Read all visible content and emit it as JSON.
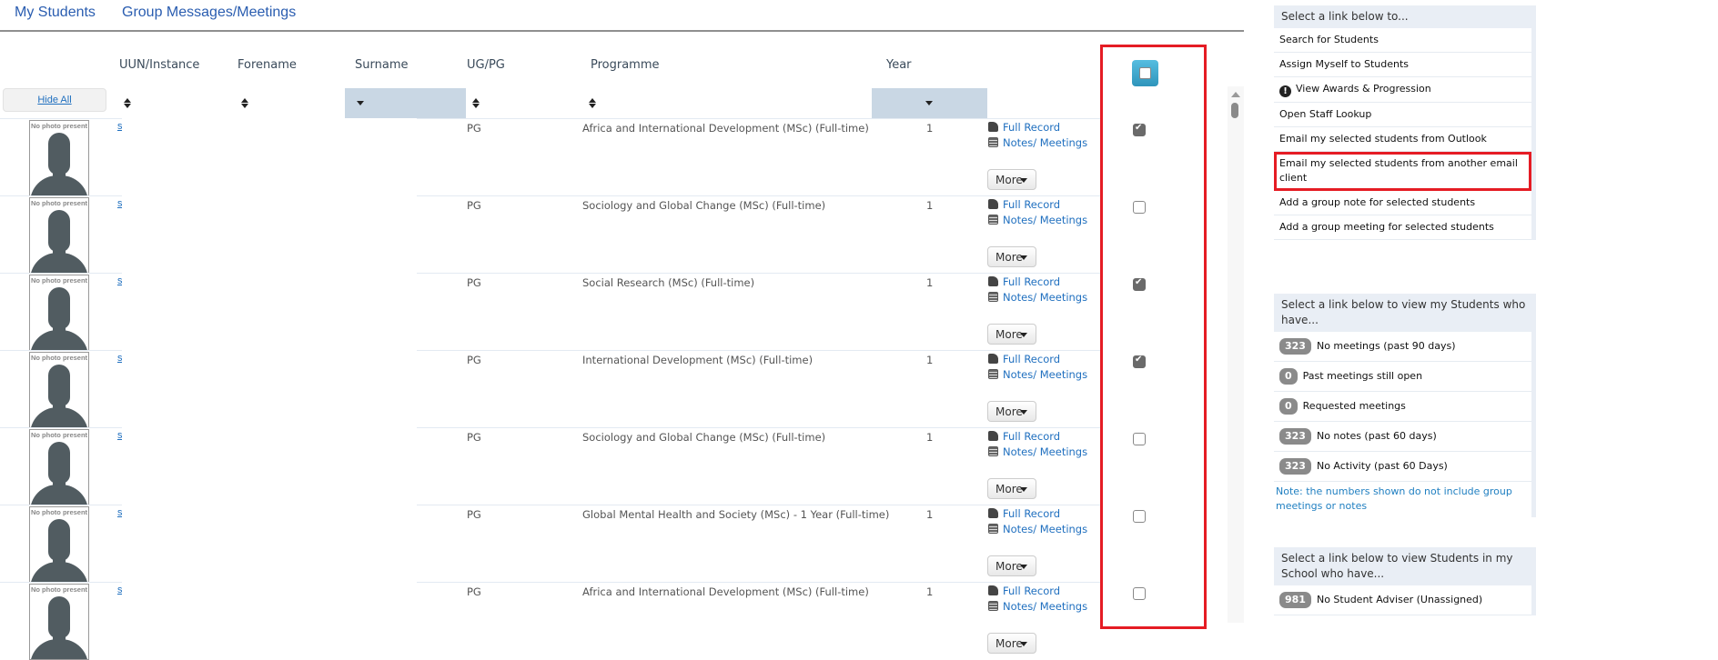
{
  "tabs": [
    {
      "label": "My Students"
    },
    {
      "label": "Group Messages/Meetings"
    }
  ],
  "table": {
    "columns": {
      "uun": "UUN/Instance",
      "forename": "Forename",
      "surname": "Surname",
      "ugpg": "UG/PG",
      "programme": "Programme",
      "year": "Year"
    },
    "hide_all_label": "Hide All",
    "photo_placeholder": "No photo present",
    "full_record_label": "Full Record",
    "notes_label": "Notes/ Meetings",
    "more_label": "More",
    "rows": [
      {
        "uun": "s",
        "ugpg": "PG",
        "programme": "Africa and International Development (MSc) (Full-time)",
        "year": "1",
        "selected": true
      },
      {
        "uun": "s",
        "ugpg": "PG",
        "programme": "Sociology and Global Change (MSc) (Full-time)",
        "year": "1",
        "selected": false
      },
      {
        "uun": "s",
        "ugpg": "PG",
        "programme": "Social Research (MSc) (Full-time)",
        "year": "1",
        "selected": true
      },
      {
        "uun": "s",
        "ugpg": "PG",
        "programme": "International Development (MSc) (Full-time)",
        "year": "1",
        "selected": true
      },
      {
        "uun": "s",
        "ugpg": "PG",
        "programme": "Sociology and Global Change (MSc) (Full-time)",
        "year": "1",
        "selected": false
      },
      {
        "uun": "s",
        "ugpg": "PG",
        "programme": "Global Mental Health and Society (MSc) - 1 Year (Full-time)",
        "year": "1",
        "selected": false
      },
      {
        "uun": "s",
        "ugpg": "PG",
        "programme": "Africa and International Development (MSc) (Full-time)",
        "year": "1",
        "selected": false
      }
    ]
  },
  "sidebar": {
    "actions_panel": {
      "title": "Select a link below to...",
      "items": [
        {
          "label": "Search for Students"
        },
        {
          "label": "Assign Myself to Students"
        },
        {
          "label": "View Awards & Progression",
          "icon": "exclamation-circle-icon"
        },
        {
          "label": "Open Staff Lookup"
        },
        {
          "label": "Email my selected students from Outlook"
        },
        {
          "label": "Email my selected students from another email client",
          "highlighted": true
        },
        {
          "label": "Add a group note for selected students"
        },
        {
          "label": "Add a group meeting for selected students"
        }
      ]
    },
    "my_students_panel": {
      "title": "Select a link below to view my Students who have...",
      "items": [
        {
          "count": "323",
          "label": "No meetings (past 90 days)"
        },
        {
          "count": "0",
          "label": "Past meetings still open"
        },
        {
          "count": "0",
          "label": "Requested meetings"
        },
        {
          "count": "323",
          "label": "No notes (past 60 days)"
        },
        {
          "count": "323",
          "label": "No Activity (past 60 Days)"
        }
      ],
      "note": "Note: the numbers shown do not include group meetings or notes"
    },
    "school_panel": {
      "title": "Select a link below to view Students in my School who have...",
      "items": [
        {
          "count": "981",
          "label": "No Student Adviser (Unassigned)"
        }
      ]
    }
  },
  "colors": {
    "link": "#1f6fbf",
    "highlight_box": "#e51c24",
    "active_filter": "#c9d7e4",
    "select_all_button": "#3aa6cf",
    "badge": "#8a8a8a"
  }
}
